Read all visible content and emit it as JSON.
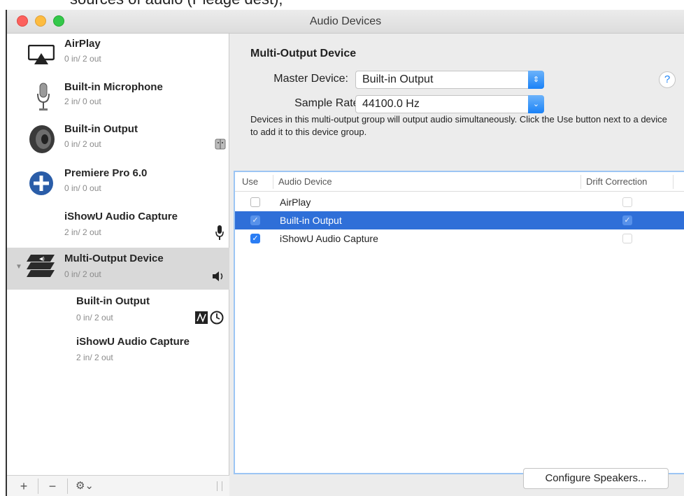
{
  "top_cropped_text": "sources of audio (Pleage dest);",
  "window": {
    "title": "Audio Devices"
  },
  "sidebar": {
    "devices": [
      {
        "name": "AirPlay",
        "io": "0 in/ 2 out",
        "icon": "airplay-icon"
      },
      {
        "name": "Built-in Microphone",
        "io": "2 in/ 0 out",
        "icon": "microphone-icon"
      },
      {
        "name": "Built-in Output",
        "io": "0 in/ 2 out",
        "icon": "speaker-icon"
      },
      {
        "name": "Premiere Pro 6.0",
        "io": "0 in/ 0 out",
        "icon": "plus-circle-icon"
      },
      {
        "name": "iShowU Audio Capture",
        "io": "2 in/ 2 out",
        "icon": "none"
      },
      {
        "name": "Multi-Output Device",
        "io": "0 in/ 2 out",
        "icon": "multi-output-icon"
      }
    ],
    "subdevices": [
      {
        "name": "Built-in Output",
        "io": "0 in/ 2 out"
      },
      {
        "name": "iShowU Audio Capture",
        "io": "2 in/ 2 out"
      }
    ],
    "bottom_buttons": {
      "add": "+",
      "remove": "−",
      "gear": "⚙⌄"
    }
  },
  "main": {
    "heading": "Multi-Output Device",
    "master_label": "Master Device:",
    "master_value": "Built-in Output",
    "rate_label": "Sample Rate:",
    "rate_value": "44100.0 Hz",
    "help": "?",
    "description": "Devices in this multi-output group will output audio simultaneously. Click the Use button next to a device to add it to this device group.",
    "table": {
      "headers": {
        "use": "Use",
        "device": "Audio Device",
        "drift": "Drift Correction"
      },
      "rows": [
        {
          "device": "AirPlay",
          "use": false,
          "drift": false,
          "selected": false
        },
        {
          "device": "Built-in Output",
          "use": true,
          "drift": true,
          "selected": true
        },
        {
          "device": "iShowU Audio Capture",
          "use": true,
          "drift": false,
          "selected": false
        }
      ]
    },
    "configure_button": "Configure Speakers..."
  },
  "colors": {
    "accent": "#2a7df4",
    "selection": "#2f6fd8",
    "sidebar_selection": "#d9d9d9"
  }
}
